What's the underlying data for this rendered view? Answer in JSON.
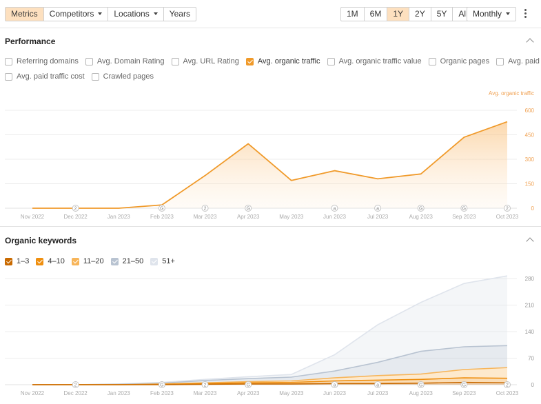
{
  "toolbar": {
    "tabs": [
      "Metrics",
      "Competitors",
      "Locations",
      "Years"
    ],
    "active_tab": "Metrics",
    "ranges": [
      "1M",
      "6M",
      "1Y",
      "2Y",
      "5Y",
      "All"
    ],
    "active_range": "1Y",
    "interval": "Monthly"
  },
  "performance": {
    "title": "Performance",
    "metrics_row1": [
      {
        "label": "Referring domains",
        "checked": false
      },
      {
        "label": "Avg. Domain Rating",
        "checked": false
      },
      {
        "label": "Avg. URL Rating",
        "checked": false
      },
      {
        "label": "Avg. organic traffic",
        "checked": true
      },
      {
        "label": "Avg. organic traffic value",
        "checked": false
      },
      {
        "label": "Organic pages",
        "checked": false
      },
      {
        "label": "Avg. paid traffic",
        "checked": false
      }
    ],
    "metrics_row2": [
      {
        "label": "Avg. paid traffic cost",
        "checked": false
      },
      {
        "label": "Crawled pages",
        "checked": false
      }
    ]
  },
  "keywords": {
    "title": "Organic keywords",
    "filters": [
      {
        "label": "1–3",
        "checked": true,
        "color": "#c96a00"
      },
      {
        "label": "4–10",
        "checked": true,
        "color": "#ef8f0f"
      },
      {
        "label": "11–20",
        "checked": true,
        "color": "#f7b55a"
      },
      {
        "label": "21–50",
        "checked": true,
        "color": "#b8c3d1"
      },
      {
        "label": "51+",
        "checked": true,
        "color": "#dfe4ec"
      }
    ]
  },
  "colors": {
    "accent": "#f09a2a",
    "active_bg": "#fde0bf"
  },
  "chart_data": [
    {
      "type": "area",
      "categories": [
        "Nov 2022",
        "Dec 2022",
        "Jan 2023",
        "Feb 2023",
        "Mar 2023",
        "Apr 2023",
        "May 2023",
        "Jun 2023",
        "Jul 2023",
        "Aug 2023",
        "Sep 2023",
        "Oct 2023"
      ],
      "series": [
        {
          "name": "Avg. organic traffic",
          "values": [
            0,
            0,
            0,
            20,
            200,
            395,
            170,
            230,
            180,
            210,
            435,
            530
          ],
          "color": "#f09a2a"
        }
      ],
      "ylabel": "Avg. organic traffic",
      "yticks": [
        0,
        150,
        300,
        450,
        600
      ],
      "ylim": [
        0,
        600
      ],
      "markers": [
        {
          "category": "Dec 2022",
          "label": "2"
        },
        {
          "category": "Feb 2023",
          "label": "G"
        },
        {
          "category": "Mar 2023",
          "label": "2"
        },
        {
          "category": "Apr 2023",
          "label": "G"
        },
        {
          "category": "Jun 2023",
          "label": "a"
        },
        {
          "category": "Jul 2023",
          "label": "a"
        },
        {
          "category": "Aug 2023",
          "label": "G"
        },
        {
          "category": "Sep 2023",
          "label": "G"
        },
        {
          "category": "Oct 2023",
          "label": "2"
        }
      ]
    },
    {
      "type": "area",
      "stacked": true,
      "categories": [
        "Nov 2022",
        "Dec 2022",
        "Jan 2023",
        "Feb 2023",
        "Mar 2023",
        "Apr 2023",
        "May 2023",
        "Jun 2023",
        "Jul 2023",
        "Aug 2023",
        "Sep 2023",
        "Oct 2023"
      ],
      "series": [
        {
          "name": "1–3",
          "values": [
            0,
            0,
            0,
            0,
            1,
            2,
            2,
            3,
            3,
            4,
            6,
            5
          ],
          "color": "#c96a00"
        },
        {
          "name": "4–10",
          "values": [
            0,
            0,
            0,
            1,
            2,
            3,
            4,
            7,
            9,
            10,
            12,
            12
          ],
          "color": "#ef8f0f"
        },
        {
          "name": "11–20",
          "values": [
            0,
            0,
            0,
            1,
            2,
            3,
            4,
            8,
            12,
            14,
            22,
            28
          ],
          "color": "#f7b55a"
        },
        {
          "name": "21–50",
          "values": [
            0,
            0,
            1,
            2,
            6,
            8,
            10,
            18,
            35,
            60,
            60,
            58
          ],
          "color": "#b8c3d1"
        },
        {
          "name": "51+",
          "values": [
            0,
            0,
            1,
            2,
            3,
            5,
            7,
            43,
            99,
            129,
            167,
            184
          ],
          "color": "#dfe4ec"
        }
      ],
      "yticks": [
        0,
        70,
        140,
        210,
        280
      ],
      "ylim": [
        0,
        280
      ],
      "markers": [
        {
          "category": "Dec 2022",
          "label": "2"
        },
        {
          "category": "Feb 2023",
          "label": "G"
        },
        {
          "category": "Mar 2023",
          "label": "2"
        },
        {
          "category": "Apr 2023",
          "label": "G"
        },
        {
          "category": "Jun 2023",
          "label": "a"
        },
        {
          "category": "Jul 2023",
          "label": "a"
        },
        {
          "category": "Aug 2023",
          "label": "G"
        },
        {
          "category": "Sep 2023",
          "label": "G"
        },
        {
          "category": "Oct 2023",
          "label": "2"
        }
      ]
    }
  ]
}
